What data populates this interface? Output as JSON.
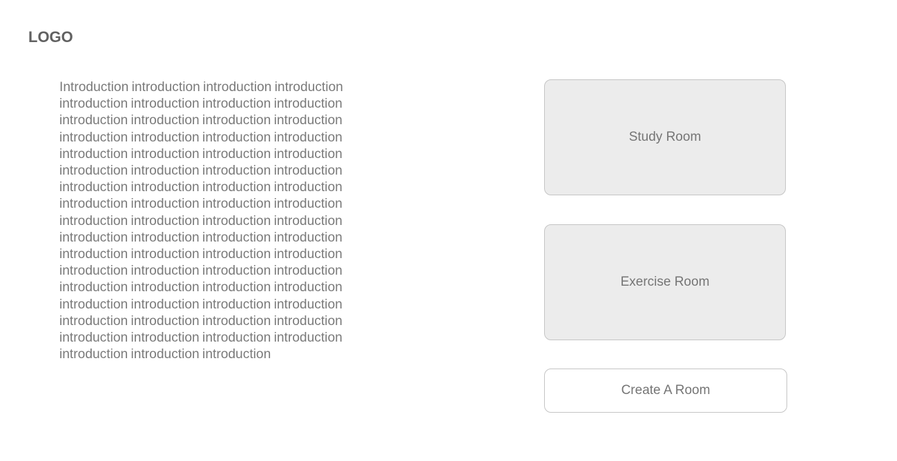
{
  "header": {
    "logo_text": "LOGO"
  },
  "intro": {
    "text": "Introduction introduction introduction introduction introduction introduction introduction introduction introduction introduction introduction introduction introduction introduction introduction introduction introduction introduction introduction introduction introduction introduction introduction introduction introduction introduction introduction introduction introduction introduction introduction introduction introduction introduction introduction introduction introduction introduction introduction introduction introduction introduction introduction introduction introduction introduction introduction introduction introduction introduction introduction introduction introduction introduction introduction introduction introduction introduction introduction introduction introduction introduction introduction introduction introduction introduction introduction"
  },
  "rooms": {
    "study_label": "Study Room",
    "exercise_label": "Exercise Room",
    "create_label": "Create A Room"
  }
}
